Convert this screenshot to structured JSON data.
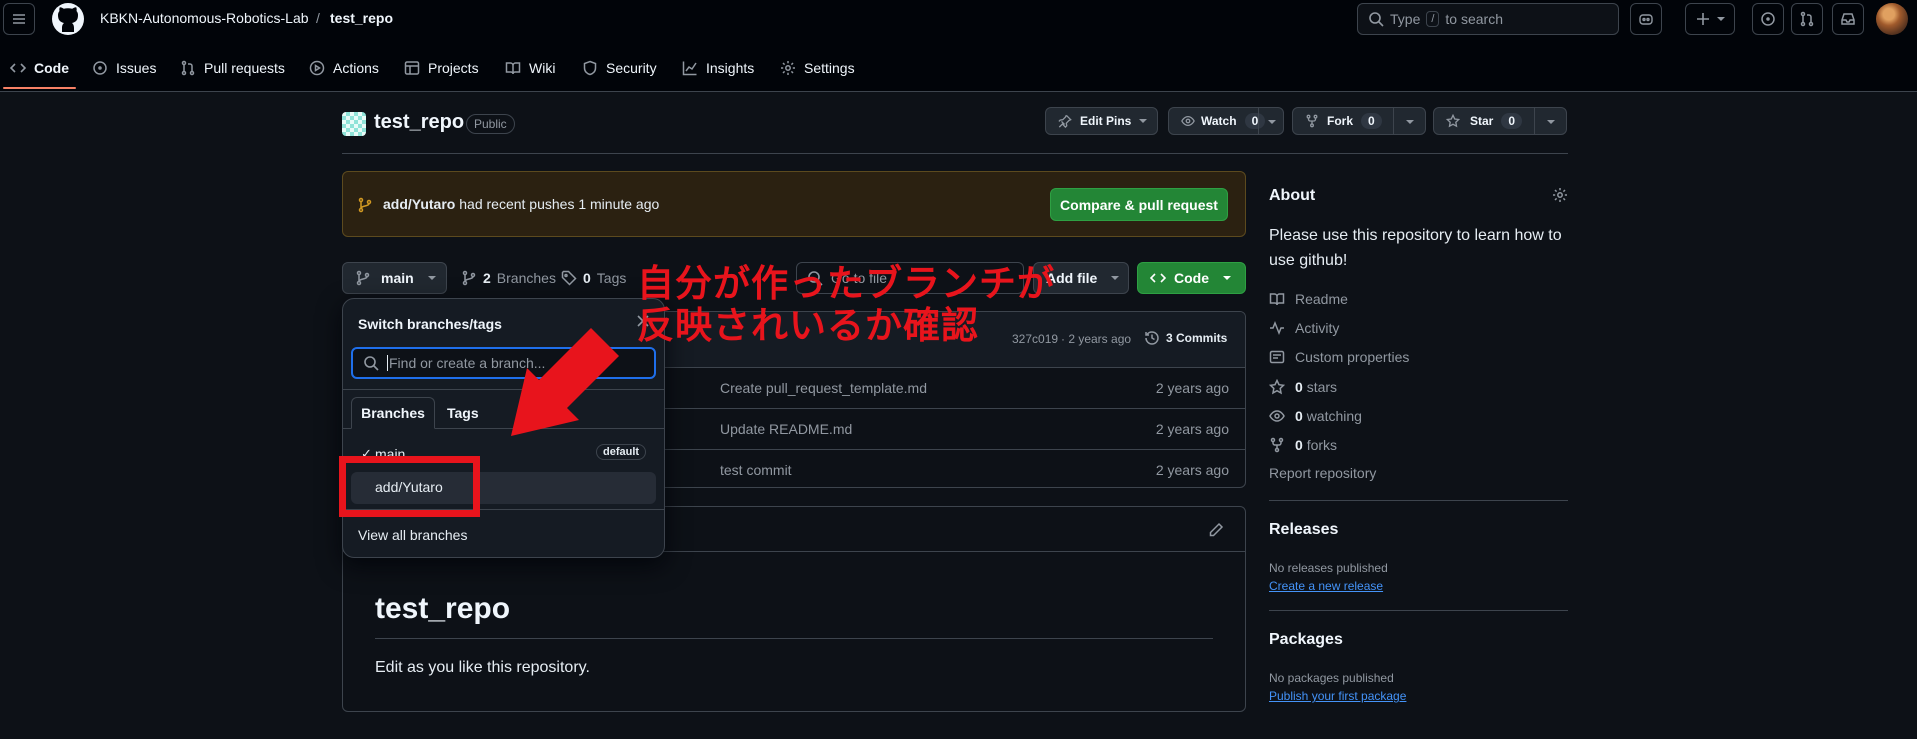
{
  "header": {
    "org": "KBKN-Autonomous-Robotics-Lab",
    "slash": "/",
    "repo": "test_repo",
    "search_placeholder_pre": "Type",
    "search_key": "/",
    "search_placeholder_post": "to search"
  },
  "nav": {
    "tabs": [
      "Code",
      "Issues",
      "Pull requests",
      "Actions",
      "Projects",
      "Wiki",
      "Security",
      "Insights",
      "Settings"
    ]
  },
  "repo": {
    "name": "test_repo",
    "visibility": "Public",
    "edit_pins": "Edit Pins",
    "watch_label": "Watch",
    "watch_count": "0",
    "fork_label": "Fork",
    "fork_count": "0",
    "star_label": "Star",
    "star_count": "0"
  },
  "banner": {
    "branch": "add/Yutaro",
    "text": "had recent pushes 1 minute ago",
    "compare_button": "Compare & pull request"
  },
  "toolbar": {
    "branch": "main",
    "branches_count": "2",
    "branches_label": "Branches",
    "tags_count": "0",
    "tags_label": "Tags",
    "goto_file": "Go to file",
    "add_file": "Add file",
    "code_button": "Code"
  },
  "commits": {
    "hash": "327c019",
    "age": "· 2 years ago",
    "count_label": "3 Commits",
    "rows": [
      {
        "message": "Create pull_request_template.md",
        "age": "2 years ago"
      },
      {
        "message": "Update README.md",
        "age": "2 years ago"
      },
      {
        "message": "test commit",
        "age": "2 years ago"
      }
    ]
  },
  "dropdown": {
    "title": "Switch branches/tags",
    "close": "×",
    "filter_placeholder": "Find or create a branch...",
    "tab_branches": "Branches",
    "tab_tags": "Tags",
    "branches": [
      {
        "name": "main",
        "badge": "default",
        "check": "✓"
      },
      {
        "name": "add/Yutaro"
      }
    ],
    "view_all": "View all branches"
  },
  "annotation": {
    "line1": "自分が作ったブランチが",
    "line2": "反映されいるか確認",
    "color": "#e8141c"
  },
  "readme": {
    "heading": "test_repo",
    "body": "Edit as you like this repository."
  },
  "about": {
    "title": "About",
    "description": "Please use this repository to learn how to use github!",
    "items": {
      "readme": "Readme",
      "activity": "Activity",
      "custom_properties": "Custom properties",
      "stars_count": "0",
      "stars_label": "stars",
      "watching_count": "0",
      "watching_label": "watching",
      "forks_count": "0",
      "forks_label": "forks",
      "report": "Report repository"
    }
  },
  "releases": {
    "title": "Releases",
    "none": "No releases published",
    "link": "Create a new release"
  },
  "packages": {
    "title": "Packages",
    "none": "No packages published",
    "link": "Publish your first package"
  },
  "colors": {
    "accent_green": "#238636",
    "link_blue": "#4493f8",
    "focus_blue": "#1f6feb",
    "banner_bg": "#2b2111",
    "active_tab": "#f78166"
  }
}
